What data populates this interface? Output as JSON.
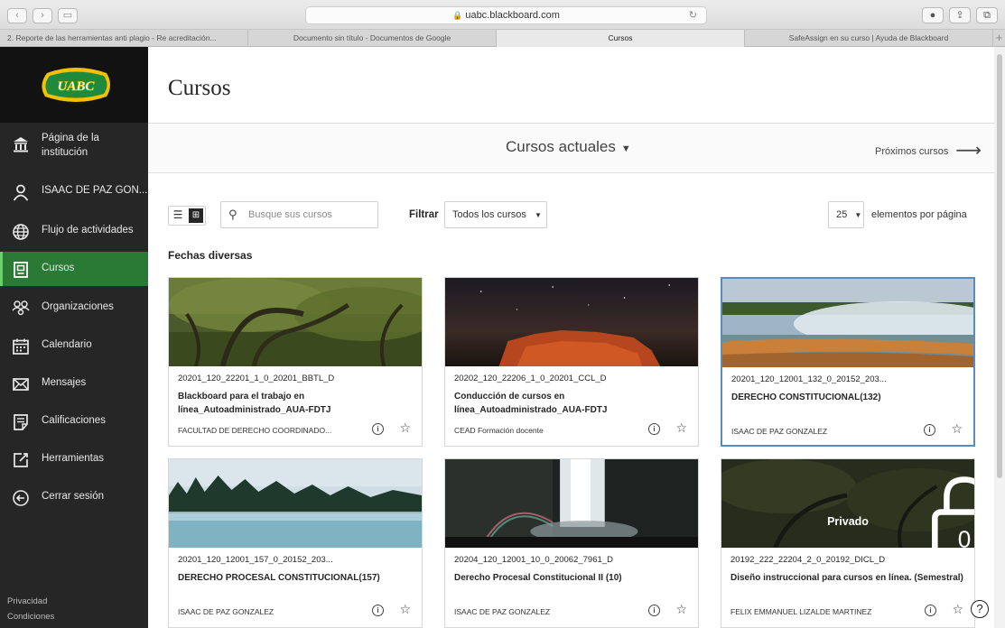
{
  "browser": {
    "url": "uabc.blackboard.com",
    "tabs": [
      {
        "label": "2. Reporte de las herramientas anti plagio - Re acreditación...",
        "active": false
      },
      {
        "label": "Documento sin título - Documentos de Google",
        "active": false
      },
      {
        "label": "Cursos",
        "active": true
      },
      {
        "label": "SafeAssign en su curso | Ayuda de Blackboard",
        "active": false
      }
    ]
  },
  "sidebar": {
    "logo_text": "UABC",
    "items": [
      {
        "label": "Página de la institución",
        "icon": "institution-icon"
      },
      {
        "label": "ISAAC DE PAZ GON...",
        "icon": "user-icon"
      },
      {
        "label": "Flujo de actividades",
        "icon": "globe-icon"
      },
      {
        "label": "Cursos",
        "icon": "courses-icon",
        "active": true
      },
      {
        "label": "Organizaciones",
        "icon": "organizations-icon"
      },
      {
        "label": "Calendario",
        "icon": "calendar-icon"
      },
      {
        "label": "Mensajes",
        "icon": "envelope-icon"
      },
      {
        "label": "Calificaciones",
        "icon": "grades-icon"
      },
      {
        "label": "Herramientas",
        "icon": "tools-icon"
      },
      {
        "label": "Cerrar sesión",
        "icon": "logout-icon"
      }
    ],
    "privacy": "Privacidad",
    "terms": "Condiciones"
  },
  "main": {
    "title": "Cursos",
    "term": "Cursos actuales",
    "next_term": "Próximos cursos",
    "search_placeholder": "Busque sus cursos",
    "filter_label": "Filtrar",
    "filter_value": "Todos los cursos",
    "per_page_value": "25",
    "per_page_label": "elementos por página",
    "group_title": "Fechas diversas"
  },
  "courses": [
    {
      "code": "20201_120_22201_1_0_20201_BBTL_D",
      "name": "Blackboard para el trabajo en línea_Autoadministrado_AUA-FDTJ",
      "instructor": "FACULTAD DE DERECHO COORDINADO...",
      "image": "forest-trees"
    },
    {
      "code": "20202_120_22206_1_0_20201_CCL_D",
      "name": "Conducción de cursos en línea_Autoadministrado_AUA-FDTJ",
      "instructor": "CEAD Formación docente",
      "image": "red-rock-night"
    },
    {
      "code": "20201_120_12001_132_0_20152_203...",
      "name": "DERECHO CONSTITUCIONAL(132)",
      "instructor": "ISAAC DE PAZ GONZALEZ",
      "image": "hot-spring",
      "selected": true
    },
    {
      "code": "20201_120_12001_157_0_20152_203...",
      "name": "DERECHO PROCESAL CONSTITUCIONAL(157)",
      "instructor": "ISAAC DE PAZ GONZALEZ",
      "image": "misty-lake"
    },
    {
      "code": "20204_120_12001_10_0_20062_7961_D",
      "name": "Derecho Procesal Constitucional II (10)",
      "instructor": "ISAAC DE PAZ GONZALEZ",
      "image": "waterfall"
    },
    {
      "code": "20192_222_22204_2_0_20192_DICL_D",
      "name": "Diseño instruccional para cursos en línea. (Semestral)",
      "instructor": "FELIX EMMANUEL LIZALDE MARTINEZ",
      "image": "private-forest",
      "private_label": "Privado"
    }
  ],
  "colors": {
    "sidebar_bg": "#262626",
    "active_nav": "#2a7a35",
    "logo_green": "#1f8a3b",
    "logo_yellow": "#f2c200"
  }
}
